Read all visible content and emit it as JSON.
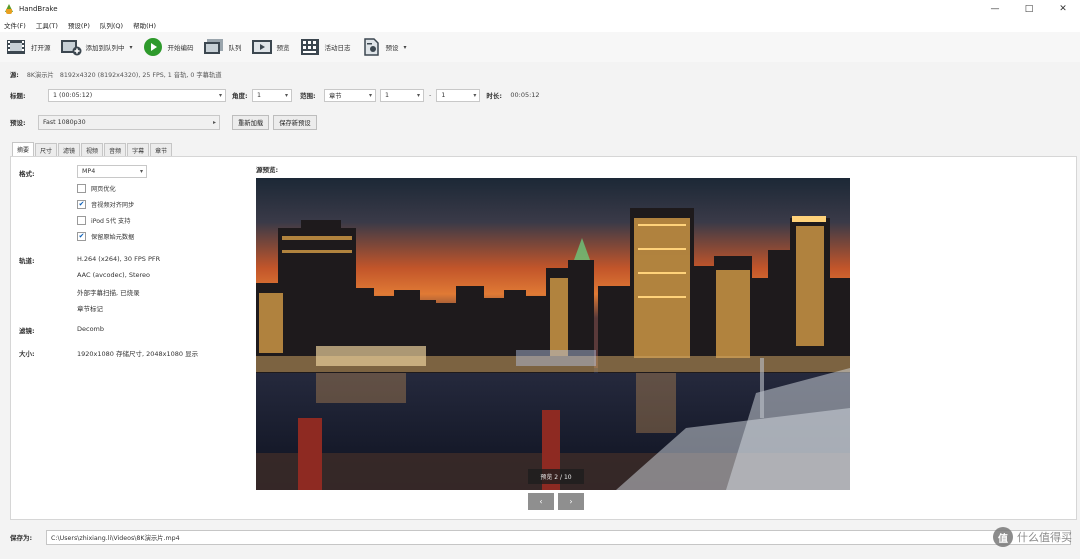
{
  "window": {
    "title": "HandBrake",
    "controls": [
      "—",
      "□",
      "✕"
    ]
  },
  "menu": [
    "文件(F)",
    "工具(T)",
    "预设(P)",
    "队列(Q)",
    "帮助(H)"
  ],
  "toolbar": {
    "open_source": "打开源",
    "add_to_queue": "添加到队列中",
    "start_encode": "开始编码",
    "queue": "队列",
    "preview": "预览",
    "activity_log": "活动日志",
    "presets": "预设",
    "dropdown_glyph": "▾"
  },
  "source": {
    "label": "源:",
    "name": "8K演示片",
    "info": "8192x4320 (8192x4320), 25 FPS, 1 音轨, 0 字幕轨道"
  },
  "title_row": {
    "title_label": "标题:",
    "title_value": "1 (00:05:12)",
    "angle_label": "角度:",
    "angle_value": "1",
    "range_label": "范围:",
    "range_type": "章节",
    "range_start": "1",
    "range_sep": "-",
    "range_end": "1",
    "duration_label": "时长:",
    "duration_value": "00:05:12"
  },
  "preset": {
    "label": "预设:",
    "value": "Fast 1080p30",
    "reload_button": "重新加载",
    "save_new_button": "保存新预设"
  },
  "tabs": [
    "摘要",
    "尺寸",
    "滤镜",
    "视频",
    "音频",
    "字幕",
    "章节"
  ],
  "summary": {
    "format_label": "格式:",
    "format_value": "MP4",
    "checks": [
      {
        "label": "网页优化",
        "checked": false
      },
      {
        "label": "音视频对齐同步",
        "checked": true
      },
      {
        "label": "iPod 5代 支持",
        "checked": false
      },
      {
        "label": "保留原始元数据",
        "checked": true
      }
    ],
    "tracks_label": "轨道:",
    "tracks": [
      "H.264 (x264), 30 FPS PFR",
      "AAC (avcodec), Stereo",
      "外部字幕扫描, 已烧录",
      "章节标记"
    ],
    "filters_label": "滤镜:",
    "filters_value": "Decomb",
    "size_label": "大小:",
    "size_value": "1920x1080 存储尺寸, 2048x1080 显示"
  },
  "preview": {
    "label": "源预览:",
    "caption": "预览 2 / 10",
    "prev": "‹",
    "next": "›"
  },
  "save": {
    "label": "保存为:",
    "path": "C:\\Users\\zhixiang.li\\Videos\\8K演示片.mp4"
  },
  "watermark": {
    "badge": "值",
    "text": "什么值得买"
  },
  "colors": {
    "toolbar_bg": "#f7f7f7",
    "panel_bg": "#ffffff",
    "check": "#0b5fb8",
    "play": "#2e9a2c"
  }
}
